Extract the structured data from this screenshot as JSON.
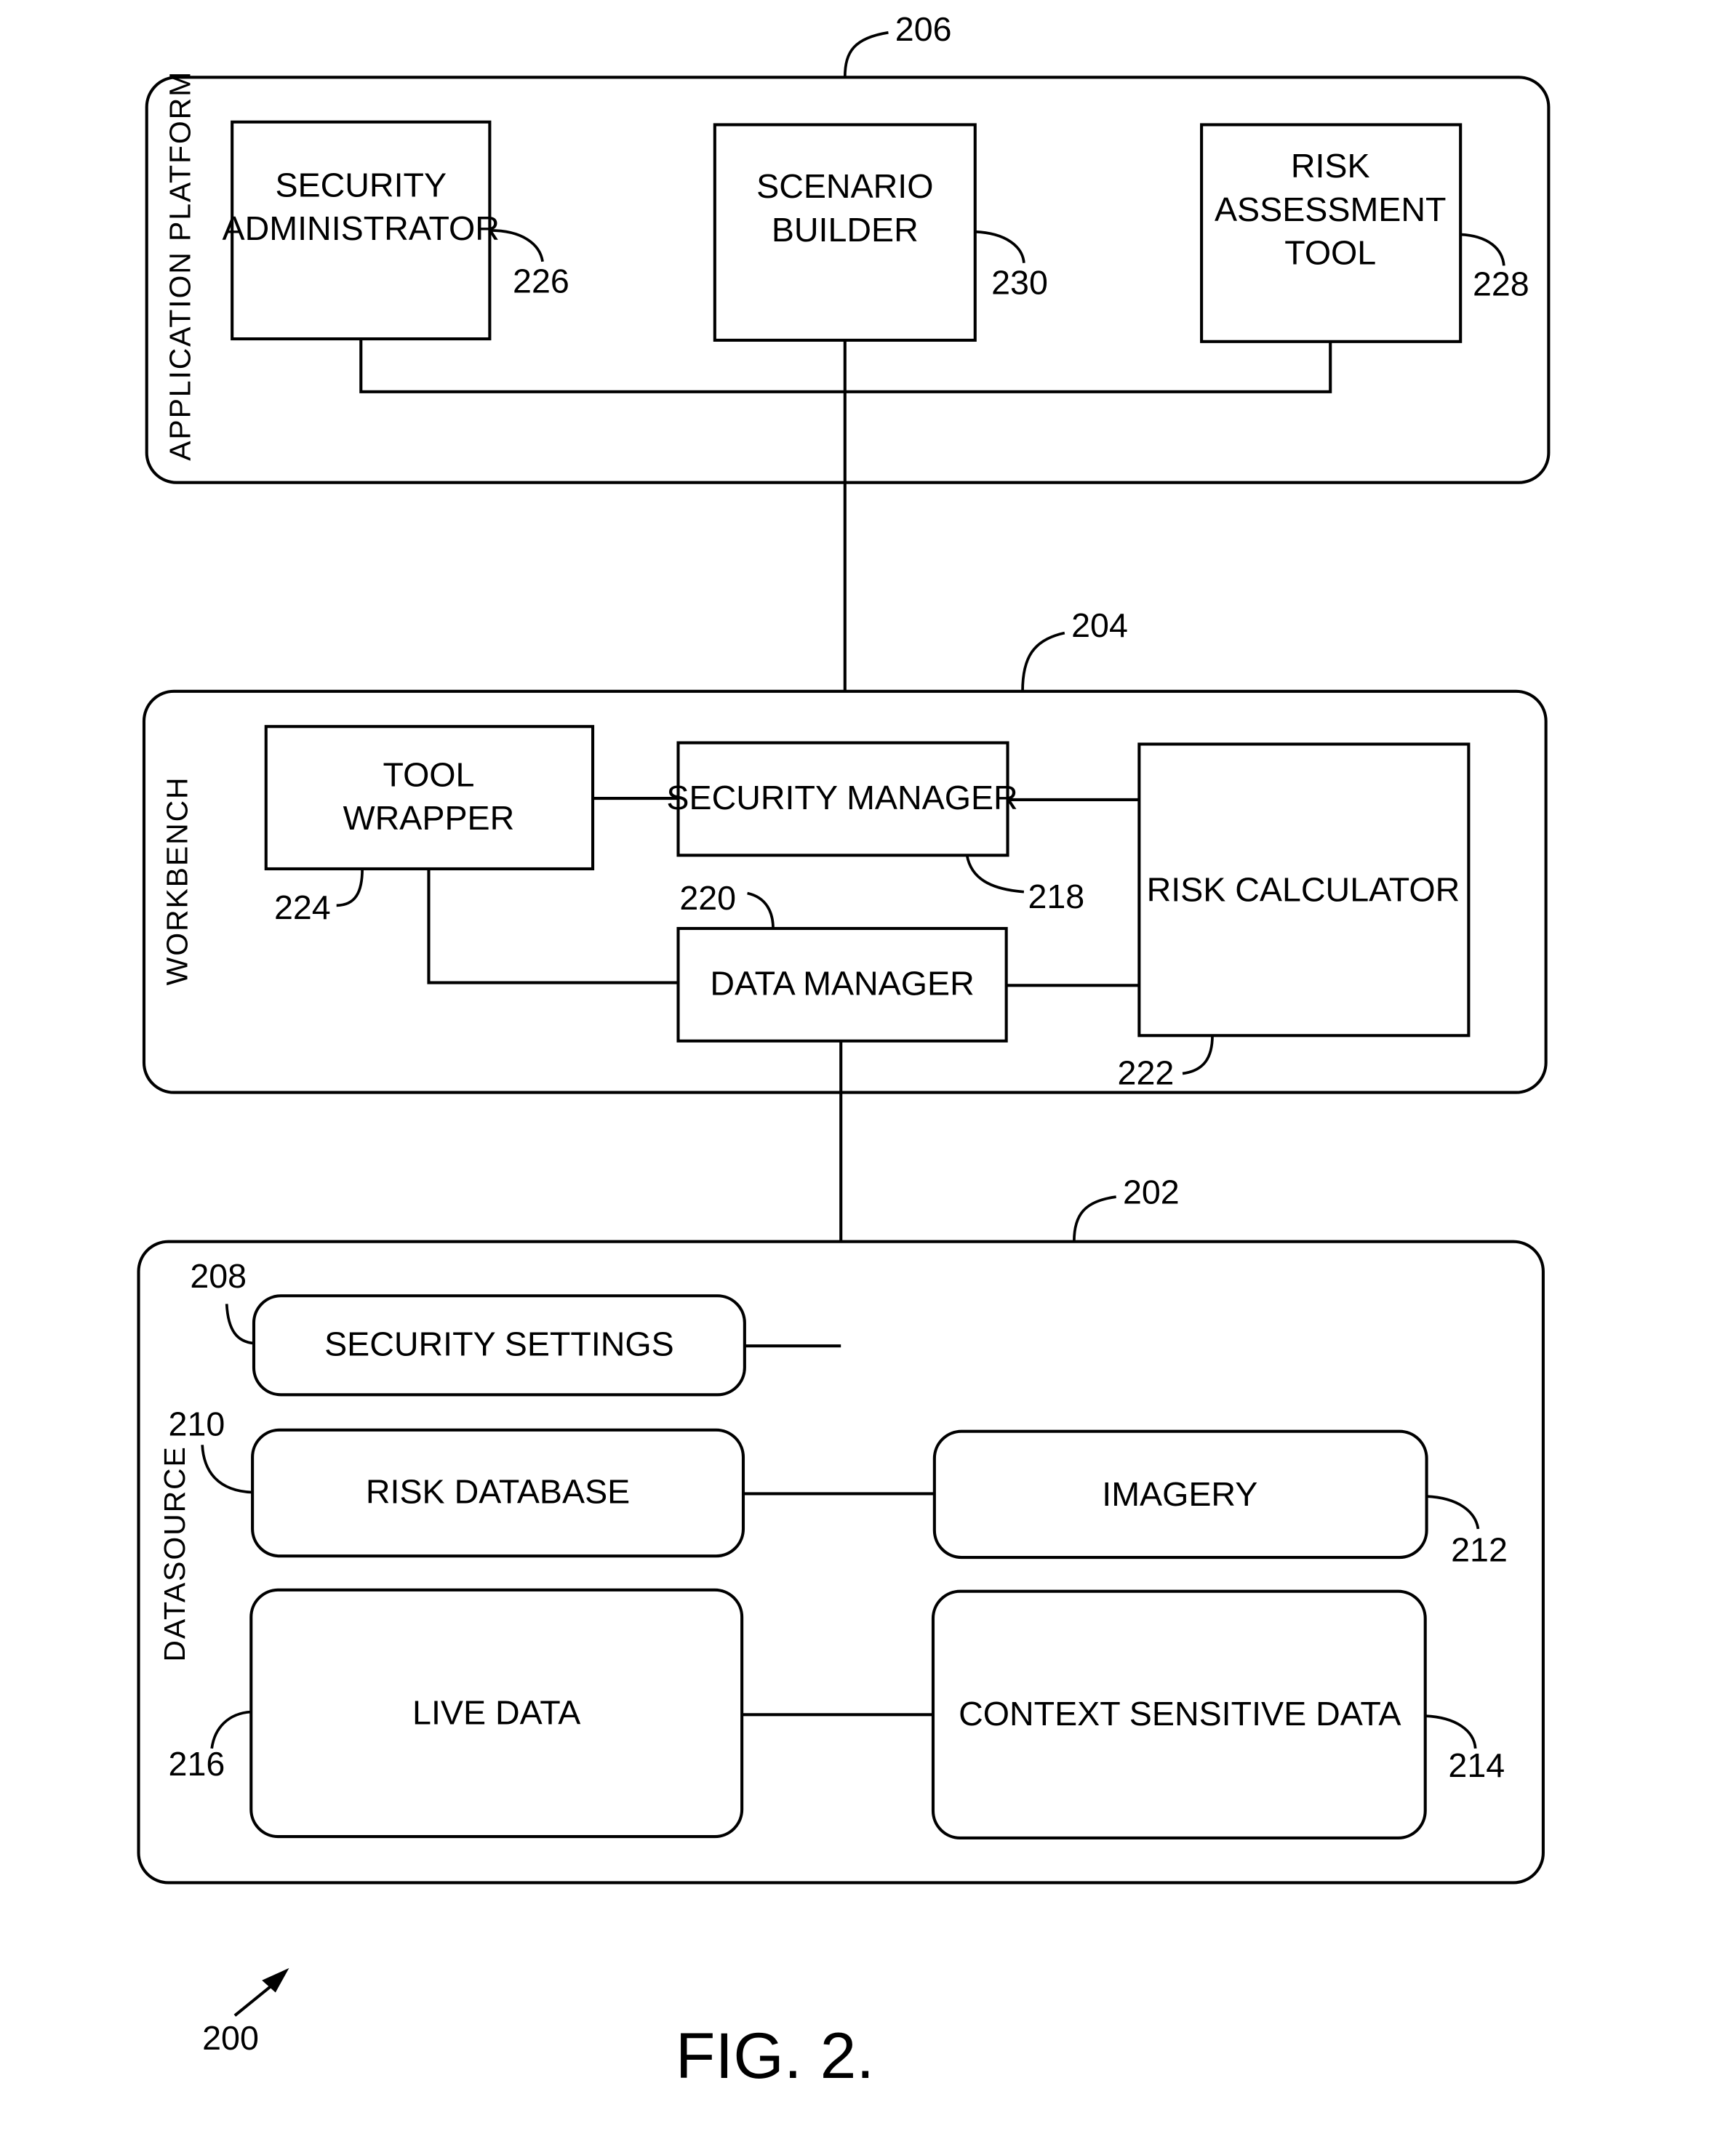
{
  "figure": {
    "title": "FIG. 2.",
    "ref": "200"
  },
  "platform": {
    "label": "APPLICATION PLATFORM",
    "ref": "206",
    "security_admin": {
      "line1": "SECURITY",
      "line2": "ADMINISTRATOR",
      "ref": "226"
    },
    "scenario_builder": {
      "line1": "SCENARIO",
      "line2": "BUILDER",
      "ref": "230"
    },
    "risk_tool": {
      "line1": "RISK",
      "line2": "ASSESSMENT",
      "line3": "TOOL",
      "ref": "228"
    }
  },
  "workbench": {
    "label": "WORKBENCH",
    "ref": "204",
    "tool_wrapper": {
      "line1": "TOOL",
      "line2": "WRAPPER",
      "ref": "224"
    },
    "security_manager": {
      "label": "SECURITY MANAGER",
      "ref": "218"
    },
    "data_manager": {
      "label": "DATA MANAGER",
      "ref": "220"
    },
    "risk_calculator": {
      "label": "RISK CALCULATOR",
      "ref": "222"
    }
  },
  "datasource": {
    "label": "DATASOURCE",
    "ref": "202",
    "security_settings": {
      "label": "SECURITY SETTINGS",
      "ref": "208"
    },
    "risk_database": {
      "label": "RISK DATABASE",
      "ref": "210"
    },
    "imagery": {
      "label": "IMAGERY",
      "ref": "212"
    },
    "context_data": {
      "label": "CONTEXT SENSITIVE DATA",
      "ref": "214"
    },
    "live_data": {
      "label": "LIVE DATA",
      "ref": "216"
    }
  }
}
